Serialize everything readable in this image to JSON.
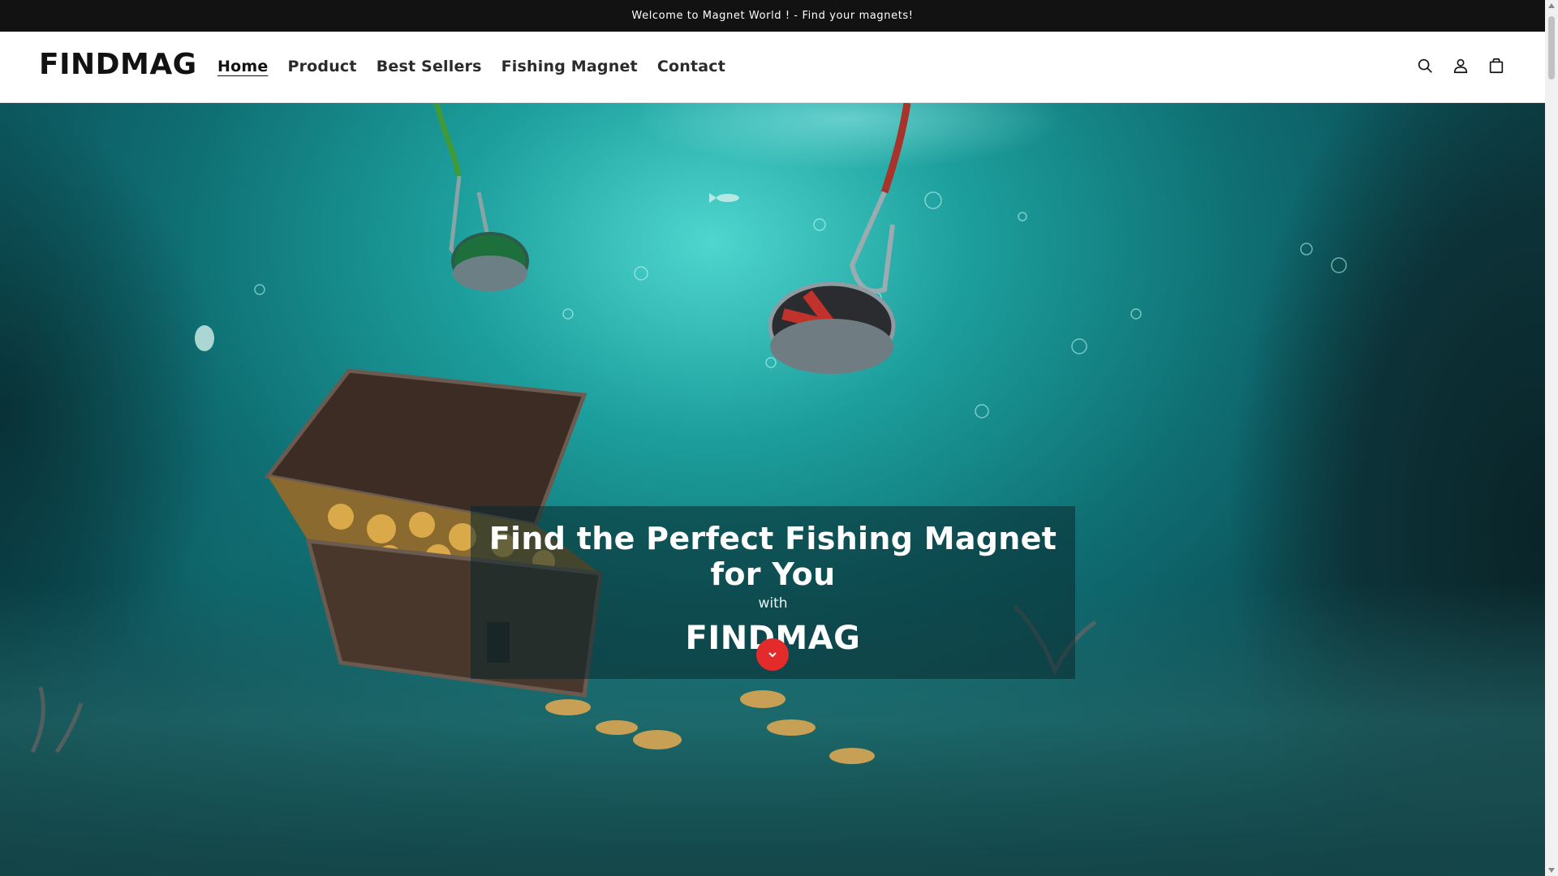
{
  "announcement": {
    "text": "Welcome to Magnet World ! - Find your magnets!"
  },
  "header": {
    "logo": "FINDMAG",
    "nav": [
      {
        "label": "Home",
        "active": true
      },
      {
        "label": "Product",
        "active": false
      },
      {
        "label": "Best Sellers",
        "active": false
      },
      {
        "label": "Fishing Magnet",
        "active": false
      },
      {
        "label": "Contact",
        "active": false
      }
    ],
    "icons": [
      "search-icon",
      "account-icon",
      "cart-icon"
    ]
  },
  "hero": {
    "title": "Find the Perfect Fishing Magnet for You",
    "with": "with",
    "brand": "FINDMAG",
    "scroll_button_icon": "chevron-down-icon",
    "accent_color": "#e42b2b"
  },
  "colors": {
    "announcement_bg": "#121212",
    "header_bg": "#ffffff",
    "water_light": "#4fd6cf",
    "water_deep": "#06262c"
  }
}
